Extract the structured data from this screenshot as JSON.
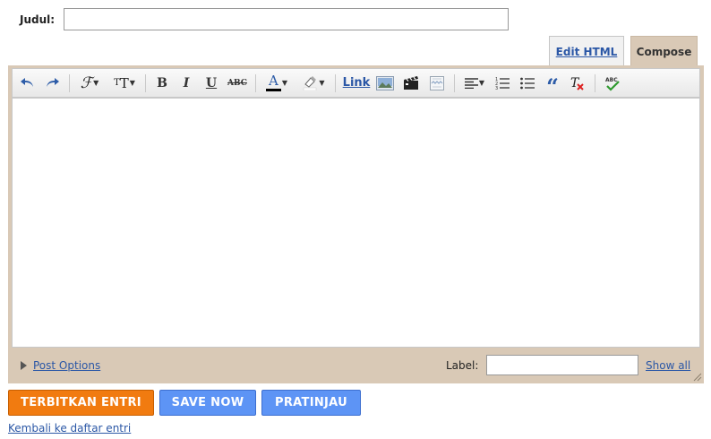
{
  "title_field": {
    "label": "Judul:",
    "value": ""
  },
  "tabs": [
    {
      "label": "Edit HTML",
      "active": false
    },
    {
      "label": "Compose",
      "active": true
    }
  ],
  "toolbar": {
    "link_label": "Link",
    "icons": [
      "undo-icon",
      "redo-icon",
      "font-family-icon",
      "font-size-icon",
      "bold-icon",
      "italic-icon",
      "underline-icon",
      "strikethrough-icon",
      "text-color-icon",
      "highlight-icon",
      "link",
      "insert-image-icon",
      "insert-video-icon",
      "jump-break-icon",
      "align-icon",
      "numbered-list-icon",
      "bullet-list-icon",
      "blockquote-icon",
      "remove-formatting-icon",
      "spellcheck-icon"
    ]
  },
  "editor": {
    "content": ""
  },
  "footer": {
    "post_options": "Post Options",
    "label_text": "Label:",
    "label_value": "",
    "show_all": "Show all"
  },
  "buttons": {
    "publish": "TERBITKAN ENTRI",
    "save": "SAVE NOW",
    "preview": "PRATINJAU"
  },
  "back_link": "Kembali ke daftar entri",
  "colors": {
    "frame": "#d9c9b6",
    "publish": "#f17b10",
    "secondary": "#5d94f5",
    "link": "#2b57a6"
  }
}
